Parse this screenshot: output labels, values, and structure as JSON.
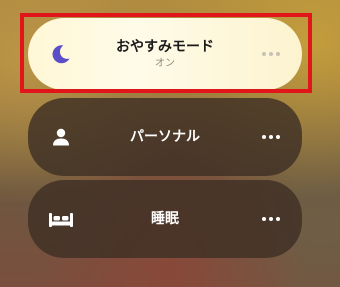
{
  "focus_modes": [
    {
      "label": "おやすみモード",
      "status": "オン",
      "icon": "moon-icon",
      "active": true,
      "accent_color": "#5b4fc8"
    },
    {
      "label": "パーソナル",
      "icon": "person-icon",
      "active": false
    },
    {
      "label": "睡眠",
      "icon": "bed-icon",
      "active": false
    }
  ],
  "colors": {
    "highlight_border": "#e0161b",
    "active_tile": "#fff7d6",
    "inactive_tile": "#3e3024"
  }
}
